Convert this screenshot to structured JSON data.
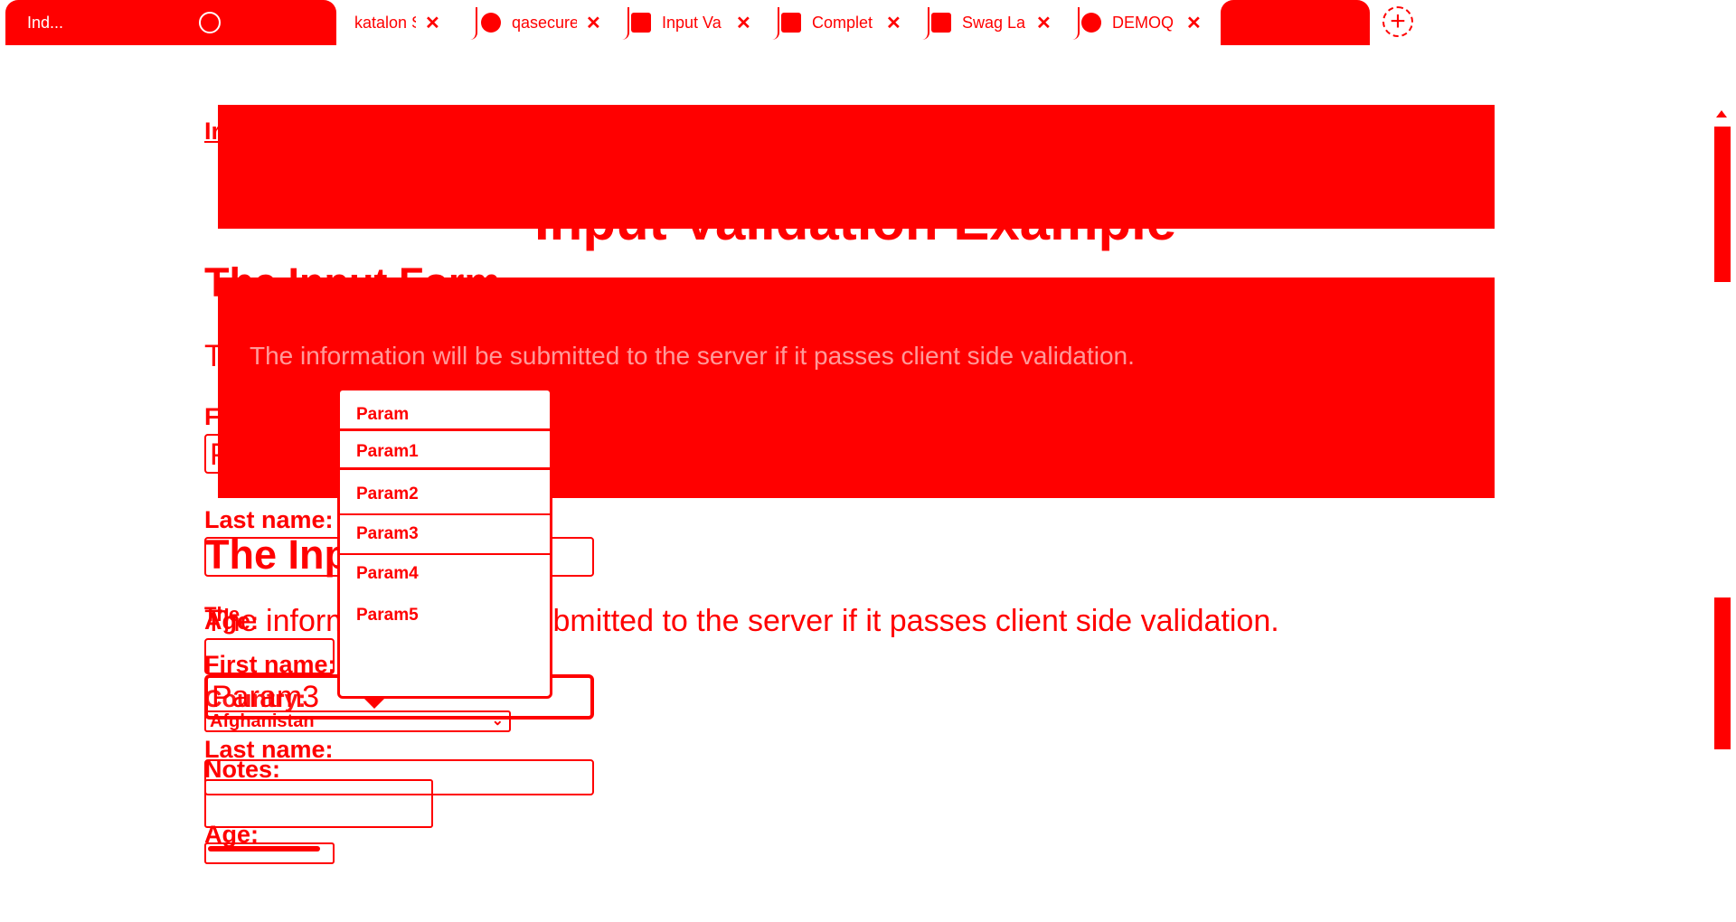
{
  "browser": {
    "tabs": [
      {
        "title": "Ind...",
        "icon": "globe-icon",
        "active": true
      },
      {
        "title": "katalon S",
        "icon": "tab-icon",
        "active": false
      },
      {
        "title": "qasecure",
        "icon": "globe-icon",
        "active": false
      },
      {
        "title": "Input Va",
        "icon": "tab-icon",
        "active": false
      },
      {
        "title": "Complet",
        "icon": "tab-icon",
        "active": false
      },
      {
        "title": "Swag La",
        "icon": "swag-icon",
        "active": false
      },
      {
        "title": "DEMOQ",
        "icon": "globe-icon",
        "active": false
      }
    ],
    "new_tab_label": "+",
    "close_label": "✕"
  },
  "page": {
    "breadcrumb": "Ir",
    "banner_title": "Input Validation Example",
    "section_title": "The Input Form",
    "intro": "The information will be submitted to the server if it passes client side validation.",
    "intro_short": "T",
    "form": {
      "first_name_label": "First name:",
      "first_name_value": "Param3",
      "first_name_short_label": "F",
      "first_name_short_value": "P",
      "last_name_label": "Last name:",
      "overlap_heading": "The Inp",
      "age_label": "Age:",
      "age_overlap_label": "The",
      "country_label": "Country:",
      "country_value": "Afghanistan",
      "notes_label": "Notes:"
    },
    "autocomplete": {
      "options": [
        "Param",
        "Param1",
        "Param2",
        "Param3",
        "Param4",
        "Param5"
      ],
      "highlighted_index": 1
    }
  },
  "colors": {
    "accent": "#ff0000",
    "background": "#ffffff"
  }
}
